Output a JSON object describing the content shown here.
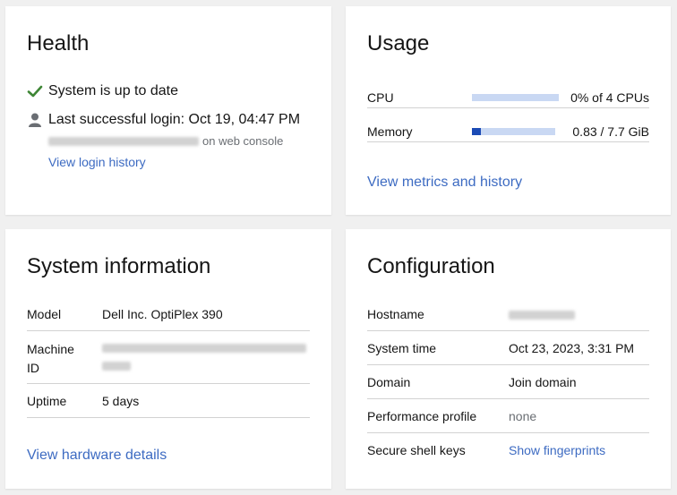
{
  "health": {
    "title": "Health",
    "status": "System is up to date",
    "login_label": "Last successful login: Oct 19, 04:47 PM",
    "login_source_suffix": "on web console",
    "view_login_history": "View login history",
    "status_color": "#3e8635"
  },
  "usage": {
    "title": "Usage",
    "cpu": {
      "label": "CPU",
      "value": "0% of 4 CPUs",
      "fraction": 0.0
    },
    "memory": {
      "label": "Memory",
      "value": "0.83 / 7.7 GiB",
      "fraction": 0.108
    },
    "view_metrics": "View metrics and history"
  },
  "system_info": {
    "title": "System information",
    "rows": [
      {
        "key": "Model",
        "value": "Dell Inc. OptiPlex 390"
      },
      {
        "key": "Machine\nID",
        "value": ""
      },
      {
        "key": "Uptime",
        "value": "5 days"
      }
    ],
    "view_hardware": "View hardware details"
  },
  "configuration": {
    "title": "Configuration",
    "rows": [
      {
        "key": "Hostname",
        "value": ""
      },
      {
        "key": "System time",
        "value": "Oct 23, 2023, 3:31 PM"
      },
      {
        "key": "Domain",
        "value": "Join domain"
      },
      {
        "key": "Performance profile",
        "value": "none"
      },
      {
        "key": "Secure shell keys",
        "value": "Show fingerprints"
      }
    ]
  },
  "colors": {
    "link": "#3d6bc2",
    "bar_track": "#c9d8f3",
    "bar_fill": "#1b4bb5"
  }
}
